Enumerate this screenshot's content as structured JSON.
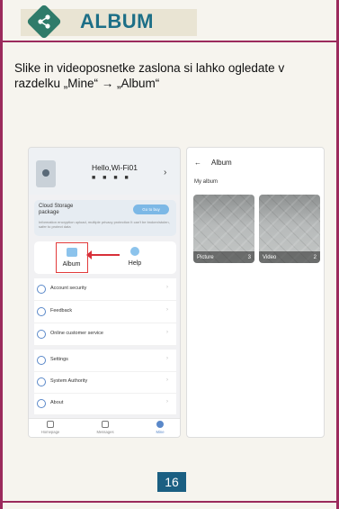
{
  "header": {
    "title": "ALBUM",
    "icon": "share-icon"
  },
  "description": "Slike in videoposnetke zaslona si lahko ogledate v razdelku „Mine“ → „Album“",
  "left_phone": {
    "greeting": "Hello,Wi-Fi01",
    "masked_id": "■ ■ ■ ■",
    "cloud": {
      "title": "Cloud Storage package",
      "subtitle": "Information encryption upload, multiple privacy protection It can't be broken/stolen, safer to protect data",
      "button": "Go to buy"
    },
    "quick_actions": {
      "album": "Album",
      "help": "Help"
    },
    "menu1": [
      "Account security",
      "Feedback",
      "Online customer service"
    ],
    "menu2": [
      "Settings",
      "System Authority",
      "About"
    ],
    "tabs": [
      {
        "label": "Homepage",
        "active": false
      },
      {
        "label": "Messages",
        "active": false
      },
      {
        "label": "Mine",
        "active": true
      }
    ]
  },
  "right_phone": {
    "back": "←",
    "title": "Album",
    "section": "My album",
    "albums": [
      {
        "label": "Picture",
        "count": "3"
      },
      {
        "label": "Video",
        "count": "2"
      }
    ]
  },
  "page_number": "16",
  "colors": {
    "frame": "#9b2a5c",
    "title": "#1d6f87",
    "accent": "#5a88c9",
    "highlight": "#e23b3b",
    "page_badge": "#1b5f82"
  }
}
